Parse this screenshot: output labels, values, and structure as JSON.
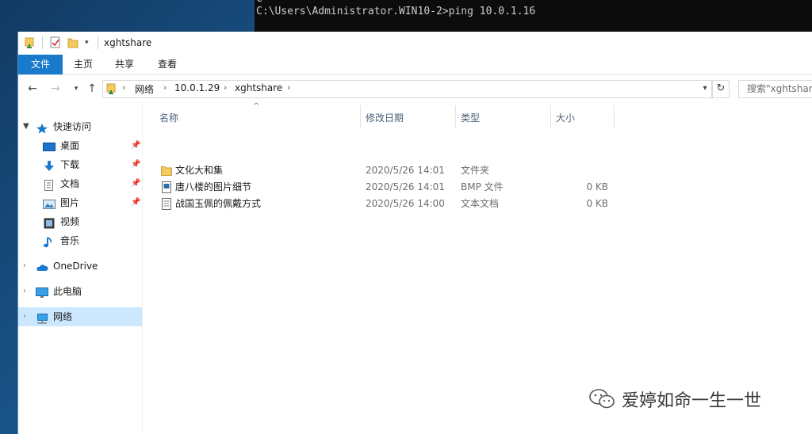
{
  "console": {
    "prev_line": "C",
    "command_line": "C:\\Users\\Administrator.WIN10-2>ping 10.0.1.16"
  },
  "window": {
    "title": "xghtshare",
    "quick_access_icons": [
      "folder-icon",
      "properties-icon",
      "new-folder-icon",
      "chevron-down-icon"
    ]
  },
  "ribbon": {
    "tabs": [
      {
        "label": "文件",
        "active": true
      },
      {
        "label": "主页",
        "active": false
      },
      {
        "label": "共享",
        "active": false
      },
      {
        "label": "查看",
        "active": false
      }
    ]
  },
  "address": {
    "segments": [
      "网络",
      "10.0.1.29",
      "xghtshare"
    ],
    "search_placeholder": "搜索\"xghtshare\""
  },
  "nav": {
    "quick_access": "快速访问",
    "quick_items": [
      {
        "label": "桌面",
        "icon": "desktop-icon",
        "pinned": true
      },
      {
        "label": "下载",
        "icon": "download-icon",
        "pinned": true
      },
      {
        "label": "文档",
        "icon": "document-icon",
        "pinned": true
      },
      {
        "label": "图片",
        "icon": "picture-icon",
        "pinned": true
      },
      {
        "label": "视频",
        "icon": "video-icon",
        "pinned": false
      },
      {
        "label": "音乐",
        "icon": "music-icon",
        "pinned": false
      }
    ],
    "onedrive": "OneDrive",
    "this_pc": "此电脑",
    "network": "网络"
  },
  "columns": {
    "name": "名称",
    "modified": "修改日期",
    "type": "类型",
    "size": "大小"
  },
  "files": [
    {
      "name": "文化大和集",
      "modified": "2020/5/26 14:01",
      "type": "文件夹",
      "size": "",
      "icon": "folder-icon"
    },
    {
      "name": "唐八楼的图片细节",
      "modified": "2020/5/26 14:01",
      "type": "BMP 文件",
      "size": "0 KB",
      "icon": "bitmap-file-icon"
    },
    {
      "name": "战国玉佩的佩戴方式",
      "modified": "2020/5/26 14:00",
      "type": "文本文档",
      "size": "0 KB",
      "icon": "text-file-icon"
    }
  ],
  "watermark": {
    "text": "爱婷如命一生一世",
    "icon": "wechat-icon"
  },
  "colors": {
    "accent": "#1979ca",
    "selection": "#cce8ff",
    "folder": "#f4c95d"
  }
}
